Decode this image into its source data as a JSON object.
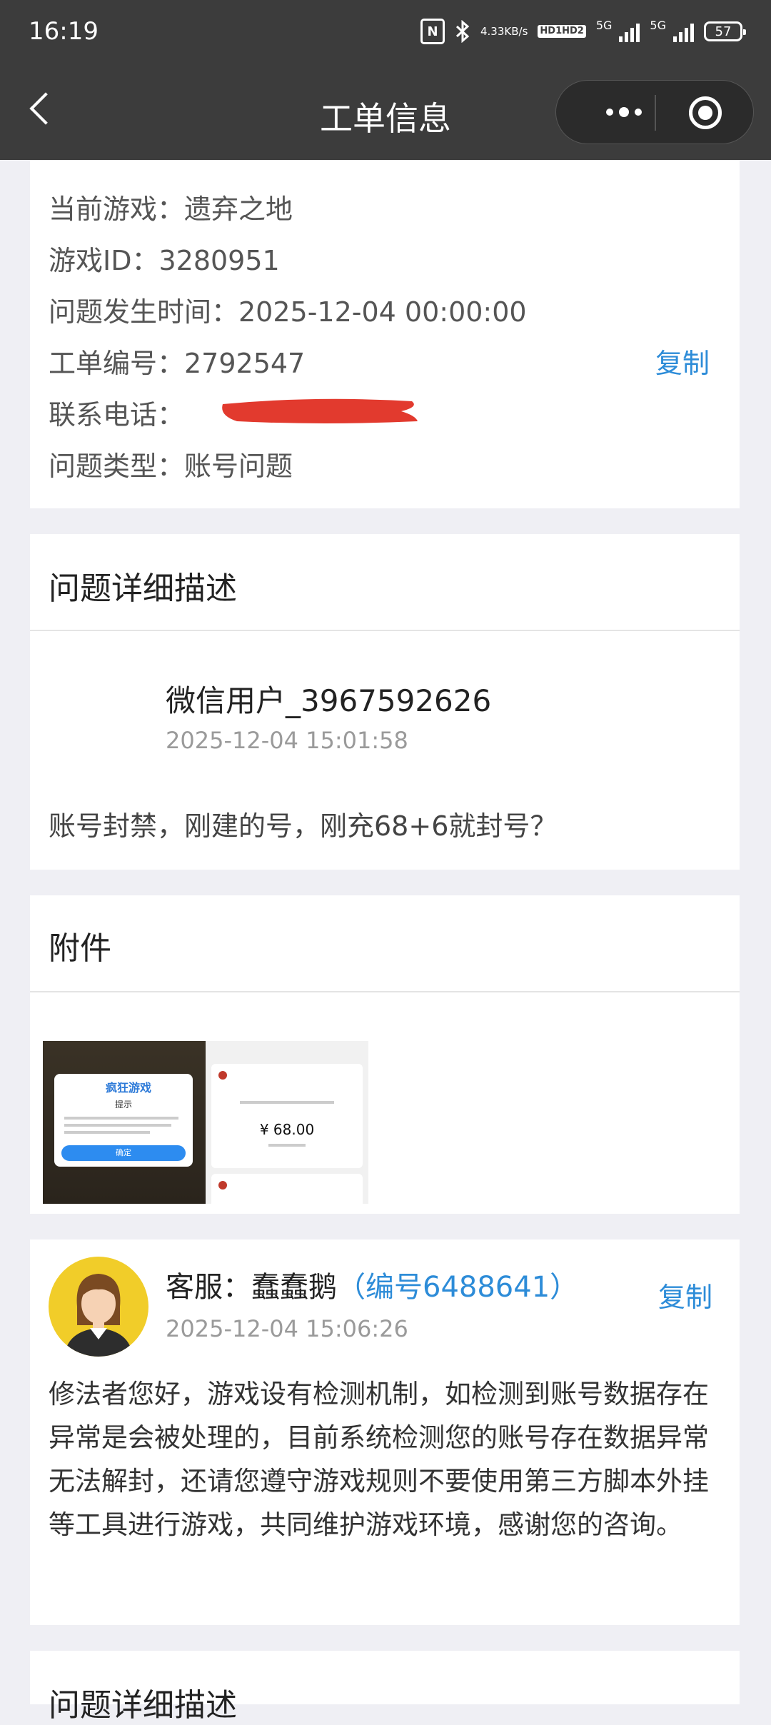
{
  "status_bar": {
    "time": "16:19",
    "nfc": "N",
    "net_speed_value": "4.33",
    "net_speed_unit": "KB/s",
    "hd1": "HD1",
    "hd2": "HD2",
    "sim1": "5G",
    "sim2": "5G",
    "battery": "57"
  },
  "nav": {
    "title": "工单信息"
  },
  "ticket": {
    "game": "当前游戏：遗弃之地",
    "game_id": "游戏ID：3280951",
    "occurred_at": "问题发生时间：2025-12-04 00:00:00",
    "ticket_no": "工单编号：2792547",
    "phone_label": "联系电话：",
    "type": "问题类型：账号问题",
    "copy_label": "复制"
  },
  "description": {
    "title": "问题详细描述",
    "user_name": "微信用户_3967592626",
    "time": "2025-12-04 15:01:58",
    "text": "账号封禁，刚建的号，刚充68+6就封号？"
  },
  "attachments": {
    "title": "附件",
    "shot1_logo": "疯狂游戏",
    "shot1_tip": "提示",
    "shot1_button": "确定",
    "shot2_amount": "¥ 68.00"
  },
  "reply": {
    "agent_prefix": "客服：蠢蠢鹅",
    "agent_number": "（编号6488641）",
    "copy_label": "复制",
    "time": "2025-12-04 15:06:26",
    "text": "修法者您好，游戏设有检测机制，如检测到账号数据存在异常是会被处理的，目前系统检测您的账号存在数据异常无法解封，还请您遵守游戏规则不要使用第三方脚本外挂等工具进行游戏，共同维护游戏环境，感谢您的咨询。"
  },
  "next_section": {
    "title": "问题详细描述"
  }
}
